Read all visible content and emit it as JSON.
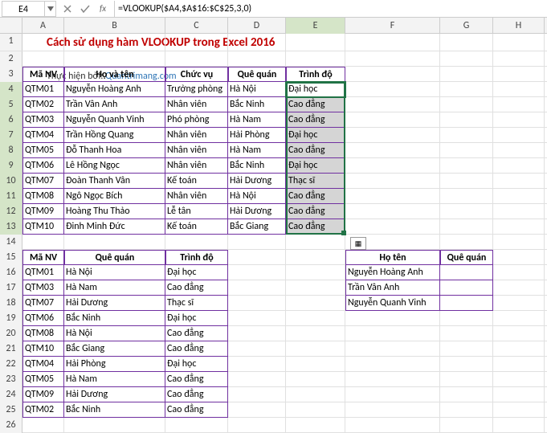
{
  "name_box": "E4",
  "formula": "=VLOOKUP($A4,$A$16:$C$25,3,0)",
  "columns": [
    "A",
    "B",
    "C",
    "D",
    "E",
    "F",
    "G",
    "H"
  ],
  "title": "Cách sử dụng hàm VLOOKUP trong Excel 2016",
  "subtitle_pre": "Thực hiện bởi: ",
  "subtitle_link": "Quantrimang.com",
  "table1_headers": [
    "Mã NV",
    "Họ và tên",
    "Chức vụ",
    "Quê quán",
    "Trình độ"
  ],
  "table1_rows": [
    [
      "QTM01",
      "Nguyễn Hoàng Anh",
      "Trưởng phòng",
      "Hà Nội",
      "Đại học"
    ],
    [
      "QTM02",
      "Trần Vân Anh",
      "Nhân viên",
      "Bắc Ninh",
      "Cao đẳng"
    ],
    [
      "QTM03",
      "Nguyễn Quanh Vinh",
      "Phó phòng",
      "Hà Nam",
      "Cao đẳng"
    ],
    [
      "QTM04",
      "Trần Hồng Quang",
      "Nhân viên",
      "Hải Phòng",
      "Đại học"
    ],
    [
      "QTM05",
      "Đỗ Thanh Hoa",
      "Nhân viên",
      "Hà Nam",
      "Cao đẳng"
    ],
    [
      "QTM06",
      "Lê Hồng Ngọc",
      "Nhân viên",
      "Bắc Ninh",
      "Đại học"
    ],
    [
      "QTM07",
      "Đoàn Thanh Vân",
      "Kế toán",
      "Hải Dương",
      "Thạc sĩ"
    ],
    [
      "QTM08",
      "Ngô Ngọc Bích",
      "Nhân viên",
      "Hà Nội",
      "Cao đẳng"
    ],
    [
      "QTM09",
      "Hoàng Thu Thảo",
      "Lễ tân",
      "Hải Dương",
      "Cao đẳng"
    ],
    [
      "QTM10",
      "Đinh Minh Đức",
      "Kế toán",
      "Bắc Giang",
      "Cao đẳng"
    ]
  ],
  "table2_headers": [
    "Mã NV",
    "Quê quán",
    "Trình độ"
  ],
  "table2_rows": [
    [
      "QTM01",
      "Hà Nội",
      "Đại học"
    ],
    [
      "QTM03",
      "Hà Nam",
      "Cao đẳng"
    ],
    [
      "QTM07",
      "Hải Dương",
      "Thạc sĩ"
    ],
    [
      "QTM06",
      "Bắc Ninh",
      "Đại học"
    ],
    [
      "QTM08",
      "Hà Nội",
      "Cao đẳng"
    ],
    [
      "QTM10",
      "Bắc Giang",
      "Cao đẳng"
    ],
    [
      "QTM04",
      "Hải Phòng",
      "Đại học"
    ],
    [
      "QTM05",
      "Hà Nam",
      "Cao đẳng"
    ],
    [
      "QTM09",
      "Hải Dương",
      "Cao đẳng"
    ],
    [
      "QTM02",
      "Bắc Ninh",
      "Cao đẳng"
    ]
  ],
  "table3_headers": [
    "Họ tên",
    "Quê quán"
  ],
  "table3_rows": [
    [
      "Nguyễn Hoàng Anh",
      ""
    ],
    [
      "Trần Vân Anh",
      ""
    ],
    [
      "Nguyễn Quanh Vinh",
      ""
    ]
  ],
  "chart_data": {
    "type": "table",
    "tables": [
      {
        "name": "employees",
        "headers": [
          "Mã NV",
          "Họ và tên",
          "Chức vụ",
          "Quê quán",
          "Trình độ"
        ],
        "rows": [
          [
            "QTM01",
            "Nguyễn Hoàng Anh",
            "Trưởng phòng",
            "Hà Nội",
            "Đại học"
          ],
          [
            "QTM02",
            "Trần Vân Anh",
            "Nhân viên",
            "Bắc Ninh",
            "Cao đẳng"
          ],
          [
            "QTM03",
            "Nguyễn Quanh Vinh",
            "Phó phòng",
            "Hà Nam",
            "Cao đẳng"
          ],
          [
            "QTM04",
            "Trần Hồng Quang",
            "Nhân viên",
            "Hải Phòng",
            "Đại học"
          ],
          [
            "QTM05",
            "Đỗ Thanh Hoa",
            "Nhân viên",
            "Hà Nam",
            "Cao đẳng"
          ],
          [
            "QTM06",
            "Lê Hồng Ngọc",
            "Nhân viên",
            "Bắc Ninh",
            "Đại học"
          ],
          [
            "QTM07",
            "Đoàn Thanh Vân",
            "Kế toán",
            "Hải Dương",
            "Thạc sĩ"
          ],
          [
            "QTM08",
            "Ngô Ngọc Bích",
            "Nhân viên",
            "Hà Nội",
            "Cao đẳng"
          ],
          [
            "QTM09",
            "Hoàng Thu Thảo",
            "Lễ tân",
            "Hải Dương",
            "Cao đẳng"
          ],
          [
            "QTM10",
            "Đinh Minh Đức",
            "Kế toán",
            "Bắc Giang",
            "Cao đẳng"
          ]
        ]
      },
      {
        "name": "lookup",
        "headers": [
          "Mã NV",
          "Quê quán",
          "Trình độ"
        ],
        "rows": [
          [
            "QTM01",
            "Hà Nội",
            "Đại học"
          ],
          [
            "QTM03",
            "Hà Nam",
            "Cao đẳng"
          ],
          [
            "QTM07",
            "Hải Dương",
            "Thạc sĩ"
          ],
          [
            "QTM06",
            "Bắc Ninh",
            "Đại học"
          ],
          [
            "QTM08",
            "Hà Nội",
            "Cao đẳng"
          ],
          [
            "QTM10",
            "Bắc Giang",
            "Cao đẳng"
          ],
          [
            "QTM04",
            "Hải Phòng",
            "Đại học"
          ],
          [
            "QTM05",
            "Hà Nam",
            "Cao đẳng"
          ],
          [
            "QTM09",
            "Hải Dương",
            "Cao đẳng"
          ],
          [
            "QTM02",
            "Bắc Ninh",
            "Cao đẳng"
          ]
        ]
      },
      {
        "name": "result",
        "headers": [
          "Họ tên",
          "Quê quán"
        ],
        "rows": [
          [
            "Nguyễn Hoàng Anh",
            ""
          ],
          [
            "Trần Vân Anh",
            ""
          ],
          [
            "Nguyễn Quanh Vinh",
            ""
          ]
        ]
      }
    ]
  }
}
